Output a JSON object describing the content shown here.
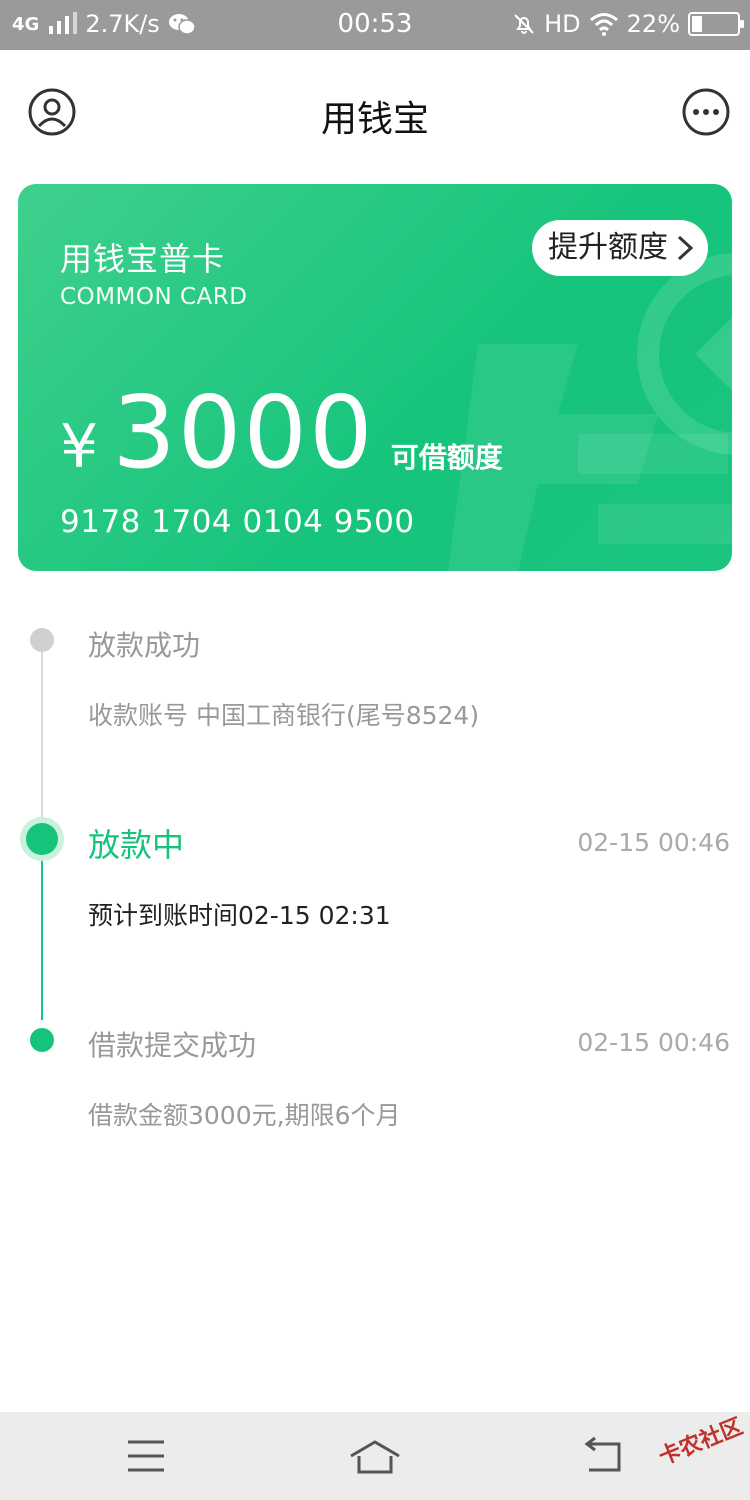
{
  "status_bar": {
    "network": "4G",
    "speed": "2.7K/s",
    "time": "00:53",
    "hd": "HD",
    "battery": "22%",
    "battery_level": 0.22
  },
  "header": {
    "title": "用钱宝"
  },
  "card": {
    "name": "用钱宝普卡",
    "subtitle": "COMMON CARD",
    "upgrade_label": "提升额度",
    "currency": "¥",
    "amount": "3000",
    "amount_label": "可借额度",
    "number": "9178  1704  0104  9500"
  },
  "timeline": [
    {
      "title": "放款成功",
      "time": "",
      "desc": "收款账号 中国工商银行(尾号8524)",
      "state": "pending"
    },
    {
      "title": "放款中",
      "time": "02-15 00:46",
      "desc": "预计到账时间02-15 02:31",
      "state": "active"
    },
    {
      "title": "借款提交成功",
      "time": "02-15 00:46",
      "desc": "借款金额3000元,期限6个月",
      "state": "done"
    }
  ],
  "watermark": "卡农社区",
  "colors": {
    "accent": "#15c47a",
    "status_bar": "#9a9a9a",
    "muted_text": "#999999"
  }
}
